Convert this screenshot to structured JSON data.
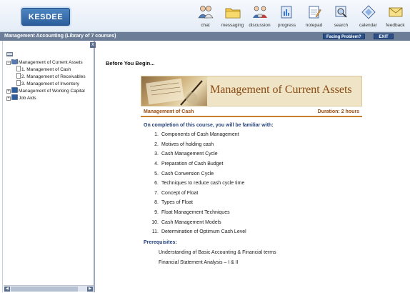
{
  "header": {
    "logo_text": "KESDEE",
    "tools": [
      {
        "label": "chat",
        "icon": "chat-icon"
      },
      {
        "label": "messaging",
        "icon": "folder-icon"
      },
      {
        "label": "discussion",
        "icon": "discussion-icon"
      },
      {
        "label": "progress",
        "icon": "progress-icon"
      },
      {
        "label": "notepad",
        "icon": "notepad-icon"
      },
      {
        "label": "search",
        "icon": "search-icon"
      },
      {
        "label": "calendar",
        "icon": "calendar-icon"
      },
      {
        "label": "feedback",
        "icon": "feedback-icon"
      }
    ]
  },
  "titlebar": {
    "title": "Management Accounting (Library of 7 courses)",
    "facing_problem": "Facing Problem?",
    "exit": "EXIT"
  },
  "tree": {
    "close": "x",
    "items": [
      {
        "label": "Management of Current Assets",
        "expanded": true,
        "children": [
          "1. Management of Cash",
          "2. Management of Receivables",
          "3. Management of Inventory"
        ]
      },
      {
        "label": "Management of Working Capital",
        "expanded": false
      },
      {
        "label": "Job Aids",
        "expanded": false
      }
    ]
  },
  "content": {
    "before": "Before You Begin...",
    "banner_title": "Management of Current Assets",
    "module": "Management of Cash",
    "duration": "Duration: 2 hours",
    "intro": "On completion of this course, you will be familiar with:",
    "objectives": [
      "Components of Cash Management",
      "Motives of holding cash",
      "Cash Management Cycle",
      "Preparation of Cash Budget",
      "Cash Conversion Cycle",
      "Techniques to reduce cash cycle time",
      "Concept of Float",
      "Types of Float",
      "Float Management Techniques",
      "Cash Management Models",
      "Determination of Optimum Cash Level"
    ],
    "prereq_heading": "Prerequisites:",
    "prerequisites": [
      "Understanding of Basic Accounting & Financial terms",
      "Financial Statement Analysis – I & II"
    ]
  },
  "colors": {
    "titlebar": "#6b7d97",
    "accent_orange": "#c87e2a",
    "heading_blue": "#23407a",
    "banner_text": "#8a4a12"
  }
}
